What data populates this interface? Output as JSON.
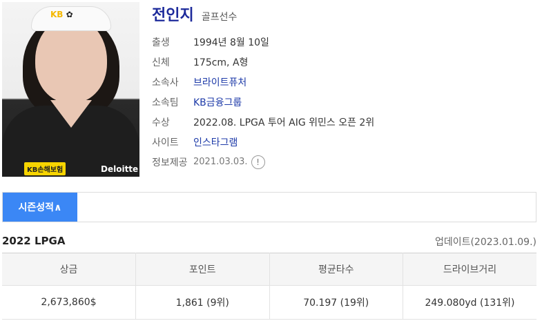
{
  "profile": {
    "name": "전인지",
    "job": "골프선수",
    "rows": [
      {
        "label": "출생",
        "value": "1994년 8월 10일"
      },
      {
        "label": "신체",
        "value": "175cm, A형"
      },
      {
        "label": "소속사",
        "value": "브라이트퓨처"
      },
      {
        "label": "소속팀",
        "value": "KB금융그룹"
      },
      {
        "label": "수상",
        "value": "2022.08. LPGA 투어 AIG 위민스 오픈 2위"
      },
      {
        "label": "사이트",
        "value": "인스타그램"
      },
      {
        "label": "정보제공",
        "value": "2021.03.03."
      }
    ],
    "info_icon": "!"
  },
  "photo": {
    "visor_logo": "KB",
    "shirt_patch": "KB손해보험",
    "shirt_sponsor": "Deloitte"
  },
  "season": {
    "tab_label": "시즌성적∧",
    "league": "2022 LPGA",
    "update": "업데이트(2023.01.09.)",
    "columns": [
      "상금",
      "포인트",
      "평균타수",
      "드라이브거리"
    ],
    "values": [
      "2,673,860$",
      "1,861 (9위)",
      "70.197 (19위)",
      "249.080yd (131위)"
    ]
  },
  "colors": {
    "accent": "#3b87f5",
    "name": "#1d2a9b",
    "link": "#1d3aa8"
  }
}
